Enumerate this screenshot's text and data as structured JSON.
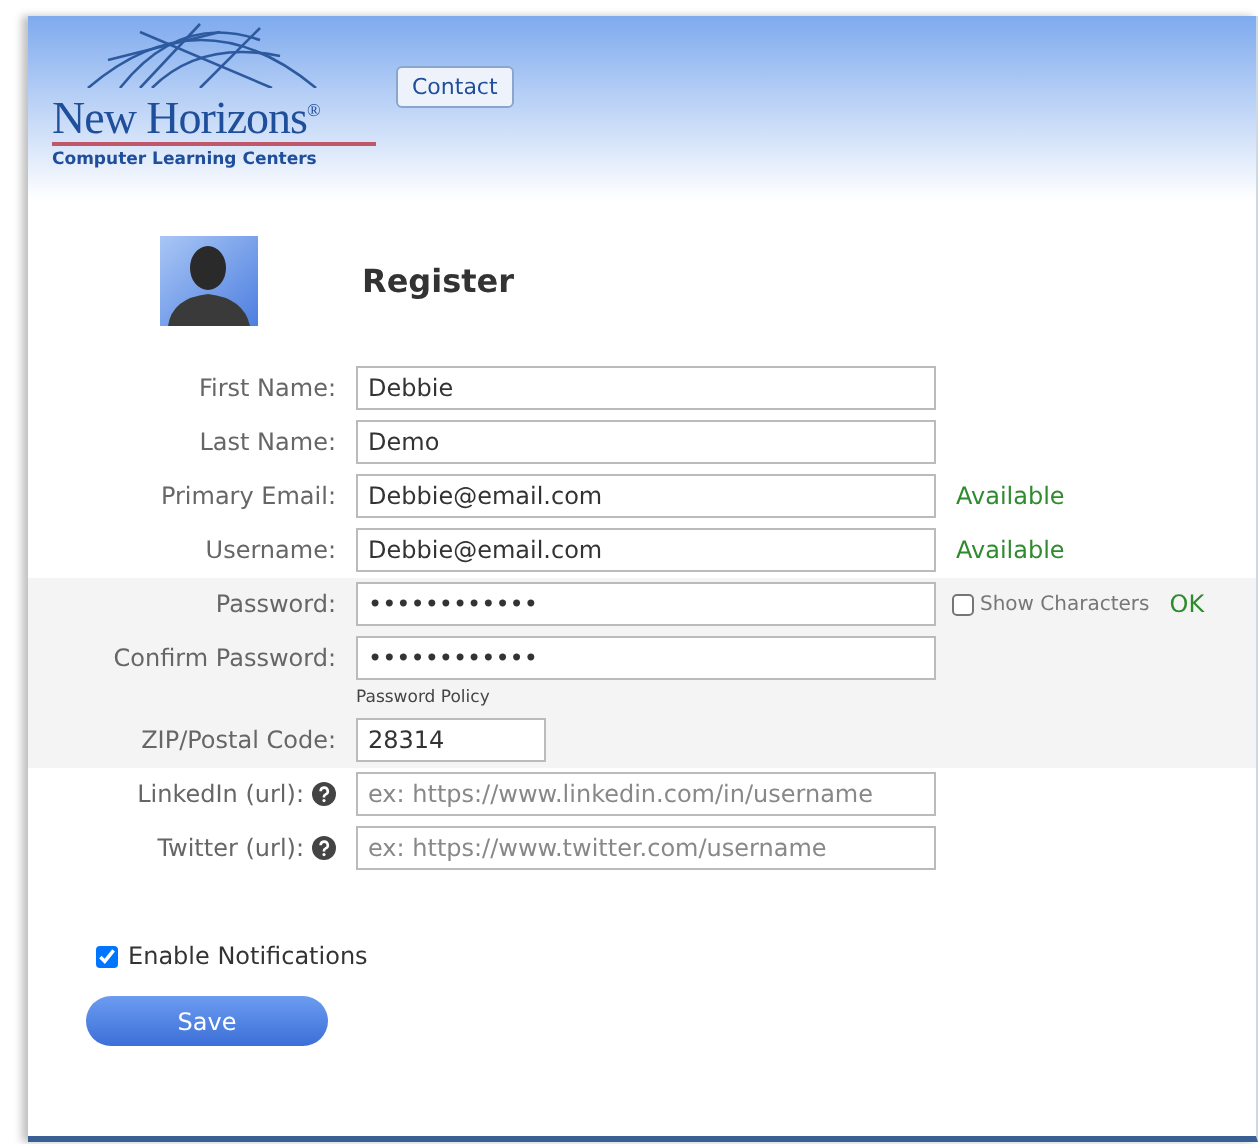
{
  "header": {
    "logo_name": "New Horizons$^{®}$",
    "logo_tagline": "Computer Learning Centers",
    "contact_button": "Contact"
  },
  "title": "Register",
  "fields": [
    {
      "label": "First Name:",
      "kind": "text",
      "value": "Debbie"
    },
    {
      "label": "Last Name:",
      "kind": "text",
      "value": "Demo"
    },
    {
      "label": "Primary Email:",
      "kind": "text",
      "value": "Debbie@email.com",
      "status": "Available"
    },
    {
      "label": "Username:",
      "kind": "text",
      "value": "Debbie@email.com",
      "status": "Available"
    }
  ],
  "password_fields": [
    {
      "label": "Password:",
      "kind": "text",
      "value": "••••••••••••",
      "show_characters": {
        "label": "Show Characters",
        "checked": false
      },
      "status": "OK"
    },
    {
      "label": "Confirm Password:",
      "kind": "text",
      "value": "••••••••••••",
      "note": "Password Policy"
    },
    {
      "label": "ZIP/Postal Code:",
      "kind": "short",
      "value": "28314"
    }
  ],
  "link_fields": [
    {
      "label": "LinkedIn (url):",
      "kind": "help",
      "placeholder": "ex: https://www.linkedin.com/in/username"
    },
    {
      "label": "Twitter (url):",
      "kind": "help",
      "placeholder": "ex: https://www.twitter.com/username"
    }
  ],
  "notifications": {
    "label": "Enable Notifications",
    "checked": true
  },
  "save_button": "Save"
}
